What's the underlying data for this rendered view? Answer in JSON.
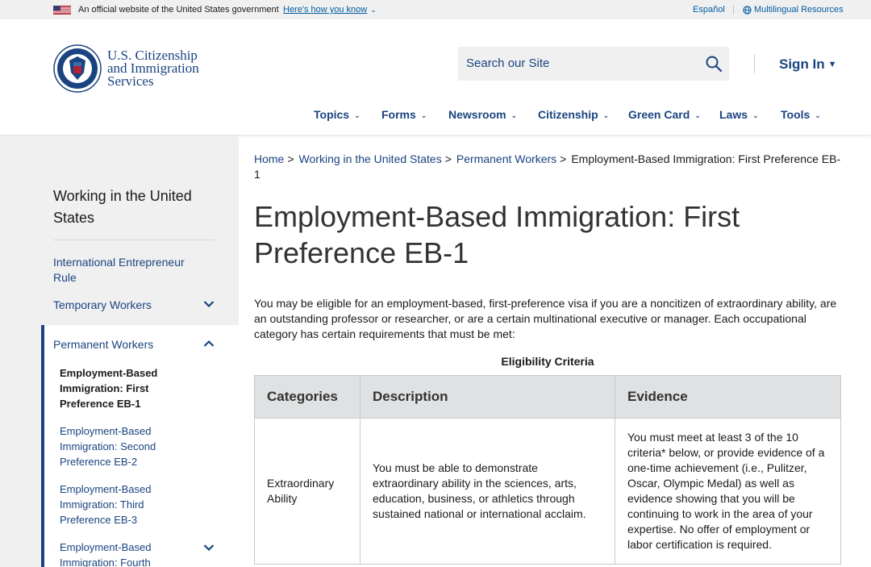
{
  "gov_banner": {
    "official_text": "An official website of the United States government",
    "how_you_know": "Here's how you know",
    "espanol": "Español",
    "multilingual": "Multilingual Resources"
  },
  "header": {
    "agency_line1": "U.S. Citizenship",
    "agency_line2": "and Immigration",
    "agency_line3": "Services",
    "search_placeholder": "Search our Site",
    "sign_in": "Sign In"
  },
  "nav": [
    {
      "label": "Topics"
    },
    {
      "label": "Forms"
    },
    {
      "label": "Newsroom"
    },
    {
      "label": "Citizenship"
    },
    {
      "label": "Green Card"
    },
    {
      "label": "Laws"
    },
    {
      "label": "Tools"
    }
  ],
  "sidebar": {
    "title": "Working in the United States",
    "items": [
      {
        "label": "International Entrepreneur Rule"
      },
      {
        "label": "Temporary Workers"
      },
      {
        "label": "Permanent Workers"
      }
    ],
    "subitems": [
      {
        "label": "Employment-Based Immigration: First Preference EB-1"
      },
      {
        "label": "Employment-Based Immigration: Second Preference EB-2"
      },
      {
        "label": "Employment-Based Immigration: Third Preference EB-3"
      },
      {
        "label": "Employment-Based Immigration: Fourth"
      }
    ]
  },
  "breadcrumb": {
    "home": "Home",
    "working": "Working in the United States",
    "permanent": "Permanent Workers",
    "current": "Employment-Based Immigration: First Preference EB-1"
  },
  "page": {
    "title": "Employment-Based Immigration: First Preference EB-1",
    "intro": "You may be eligible for an employment-based, first-preference visa if you are a noncitizen of extraordinary ability, are an outstanding professor or researcher, or are a certain multinational executive or manager. Each occupational category has certain requirements that must be met:",
    "table_caption": "Eligibility Criteria"
  },
  "table": {
    "headers": [
      "Categories",
      "Description",
      "Evidence"
    ],
    "rows": [
      {
        "category": "Extraordinary Ability",
        "description": "You must be able to demonstrate extraordinary ability in the sciences, arts, education, business, or athletics through sustained national or international acclaim.",
        "evidence": "You must meet at least 3 of the 10 criteria* below, or provide evidence of a one-time achievement (i.e., Pulitzer, Oscar, Olympic Medal) as well as evidence showing that you will be continuing to work in the area of your expertise. No offer of employment or labor certification is required."
      }
    ]
  },
  "colors": {
    "primary": "#1a4480",
    "link": "#005ea2",
    "sidebar_bg": "#f0f0f0",
    "table_header_bg": "#dfe1e2"
  },
  "icons": [
    "us-flag-icon",
    "chevron-down-icon",
    "globe-icon",
    "dhs-seal-icon",
    "search-icon",
    "caret-down-icon",
    "chevron-up-icon"
  ]
}
